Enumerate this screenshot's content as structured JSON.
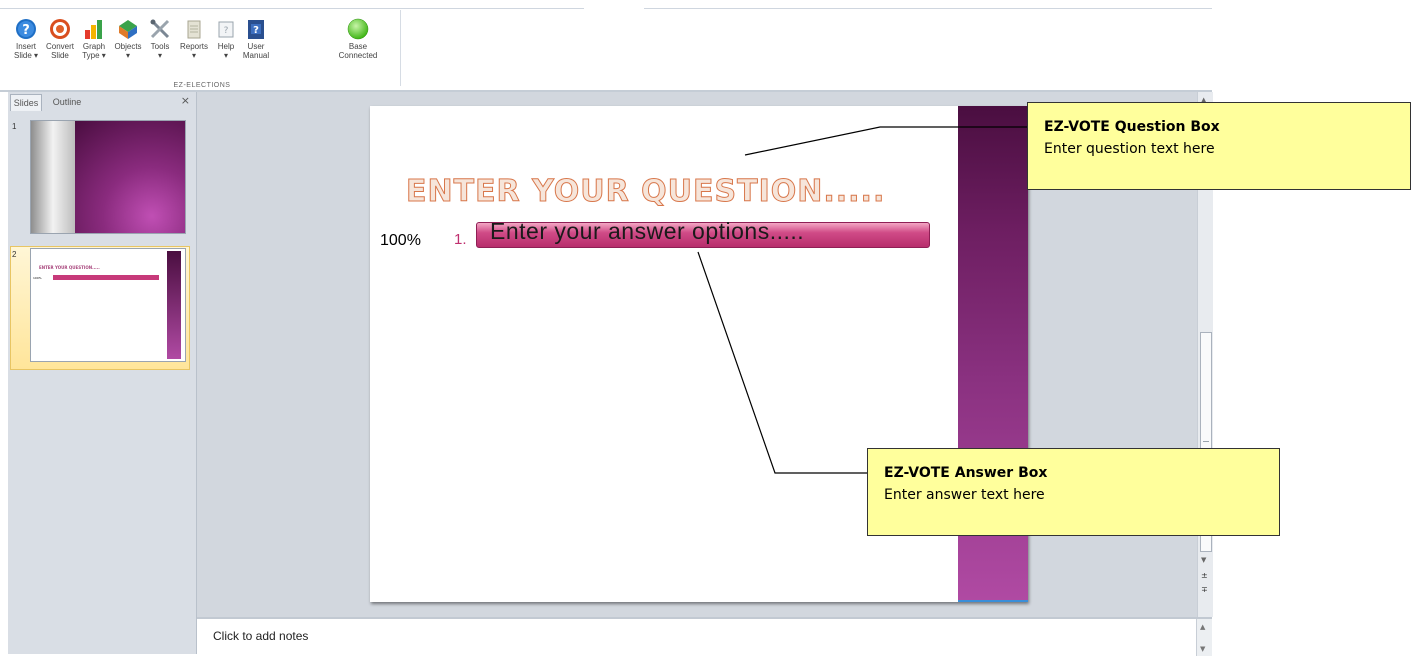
{
  "ribbon": {
    "buttons": [
      {
        "label": "Insert\nSlide ▾",
        "icon": "help-question-icon",
        "color": "#1f6fc5"
      },
      {
        "label": "Convert\nSlide",
        "icon": "target-icon",
        "color": "#e0602a"
      },
      {
        "label": "Graph\nType ▾",
        "icon": "bar-chart-icon",
        "color": "#e8a42a"
      },
      {
        "label": "Objects\n▾",
        "icon": "objects-icon",
        "color": "#3aa34a"
      },
      {
        "label": "Tools\n▾",
        "icon": "tools-icon",
        "color": "#7b8794"
      },
      {
        "label": "Reports\n▾",
        "icon": "reports-icon",
        "color": "#b4b4a0"
      },
      {
        "label": "Help\n▾",
        "icon": "help-book-icon",
        "color": "#9aa4ad"
      },
      {
        "label": "User\nManual",
        "icon": "user-manual-icon",
        "color": "#2a4f8f"
      },
      {
        "label": "Base\nConnected",
        "icon": "connected-status-icon",
        "color": "#4cc61e"
      }
    ],
    "group_label": "EZ-ELECTIONS"
  },
  "left_pane": {
    "tabs": [
      "Slides",
      "Outline"
    ],
    "close": "×",
    "slides": [
      {
        "number": "1"
      },
      {
        "number": "2",
        "title_mini": "ENTER YOUR QUESTION.....",
        "pct_mini": "100%"
      }
    ]
  },
  "slide": {
    "question": "ENTER YOUR QUESTION.....",
    "percent": "100%",
    "option_number": "1.",
    "answer": "Enter your answer options....."
  },
  "notes": {
    "placeholder": "Click to add notes"
  },
  "callouts": {
    "question": {
      "title": "EZ-VOTE Question Box",
      "body": "Enter question text here"
    },
    "answer": {
      "title": "EZ-VOTE Answer Box",
      "body": "Enter answer text here"
    }
  },
  "colors": {
    "callout_bg": "#ffff9c",
    "slide_band": "#8a3180",
    "answer_bar": "#c73a7a"
  }
}
